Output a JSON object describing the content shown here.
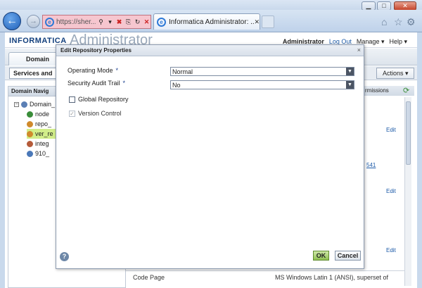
{
  "browser": {
    "url_text": "https://sher...",
    "tab_title": "Informatica Administrator: ...",
    "tab_close": "✕"
  },
  "app": {
    "brand": "INFORMATICA",
    "brand_sub": "Administrator",
    "user": "Administrator",
    "logout": "Log Out",
    "manage": "Manage ▾",
    "help": "Help ▾",
    "domain_tab": "Domain",
    "services_tab": "Services and",
    "actions": "Actions ▾",
    "nav_title": "Domain Navig",
    "permissions": "rmissions",
    "tree": [
      "Domain_",
      "node",
      "repo_",
      "ver_re",
      "integ",
      "910_"
    ],
    "edit_labels": [
      "Edit",
      "Edit",
      "Edit"
    ],
    "link_541": "541",
    "code_page_label": "Code Page",
    "code_page_value": "MS Windows Latin 1 (ANSI), superset of"
  },
  "dialog": {
    "title": "Edit Repository Properties",
    "close": "×",
    "operating_mode_label": "Operating Mode",
    "operating_mode_value": "Normal",
    "audit_trail_label": "Security Audit Trail",
    "audit_trail_value": "No",
    "required_mark": "*",
    "global_repo_label": "Global Repository",
    "version_control_label": "Version Control",
    "ok": "OK",
    "cancel": "Cancel",
    "help": "?"
  }
}
